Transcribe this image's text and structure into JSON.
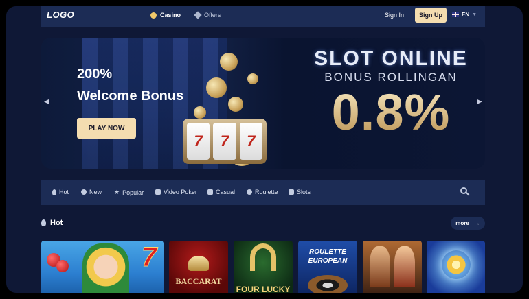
{
  "header": {
    "logo": "LOGO",
    "nav": [
      {
        "label": "Casino",
        "icon": "casino-chip-icon"
      },
      {
        "label": "Offers",
        "icon": "diamond-icon"
      }
    ],
    "signin_label": "Sign In",
    "signup_label": "Sign Up",
    "language": "EN"
  },
  "banner": {
    "bonus_percent": "200%",
    "bonus_title": "Welcome Bonus",
    "cta_label": "PLAY NOW",
    "promo_line1": "SLOT ONLINE",
    "promo_line2": "BONUS ROLLINGAN",
    "promo_value": "0.8%",
    "reel_symbol": "7"
  },
  "categories": [
    {
      "label": "Hot",
      "icon": "flame-icon"
    },
    {
      "label": "New",
      "icon": "new-icon"
    },
    {
      "label": "Popular",
      "icon": "star-icon"
    },
    {
      "label": "Video Poker",
      "icon": "shield-icon"
    },
    {
      "label": "Casual",
      "icon": "grid-icon"
    },
    {
      "label": "Roulette",
      "icon": "roulette-icon"
    },
    {
      "label": "Slots",
      "icon": "slots-icon"
    }
  ],
  "hot_section": {
    "title": "Hot",
    "more_label": "more",
    "more_arrow": "→"
  },
  "games": [
    {
      "label": "7"
    },
    {
      "label": "BACCARAT"
    },
    {
      "label": "FOUR LUCKY"
    },
    {
      "label": "ROULETTE EUROPEAN"
    },
    {
      "label": ""
    },
    {
      "label": ""
    }
  ],
  "colors": {
    "background": "#0f1836",
    "panel": "#1c2c55",
    "accent": "#f4ddb0"
  }
}
